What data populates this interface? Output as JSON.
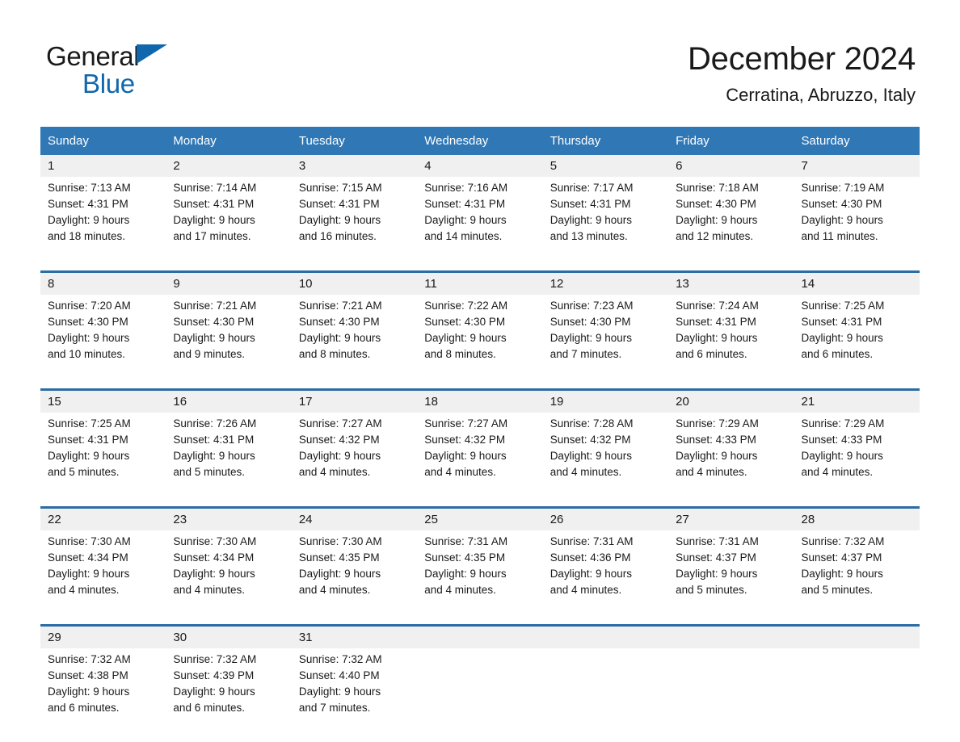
{
  "brand": {
    "name_part1": "General",
    "name_part2": "Blue",
    "triangle_color": "#1067ad",
    "accent_color": "#3077b6"
  },
  "header": {
    "title": "December 2024",
    "subtitle": "Cerratina, Abruzzo, Italy"
  },
  "calendar": {
    "weekdays": [
      "Sunday",
      "Monday",
      "Tuesday",
      "Wednesday",
      "Thursday",
      "Friday",
      "Saturday"
    ],
    "header_bg": "#3077b6",
    "date_band_bg": "#f0f0f0",
    "week_rule_color": "#2b6ca3",
    "weeks": [
      [
        {
          "day": "1",
          "sunrise": "Sunrise: 7:13 AM",
          "sunset": "Sunset: 4:31 PM",
          "daylight_line1": "Daylight: 9 hours",
          "daylight_line2": "and 18 minutes."
        },
        {
          "day": "2",
          "sunrise": "Sunrise: 7:14 AM",
          "sunset": "Sunset: 4:31 PM",
          "daylight_line1": "Daylight: 9 hours",
          "daylight_line2": "and 17 minutes."
        },
        {
          "day": "3",
          "sunrise": "Sunrise: 7:15 AM",
          "sunset": "Sunset: 4:31 PM",
          "daylight_line1": "Daylight: 9 hours",
          "daylight_line2": "and 16 minutes."
        },
        {
          "day": "4",
          "sunrise": "Sunrise: 7:16 AM",
          "sunset": "Sunset: 4:31 PM",
          "daylight_line1": "Daylight: 9 hours",
          "daylight_line2": "and 14 minutes."
        },
        {
          "day": "5",
          "sunrise": "Sunrise: 7:17 AM",
          "sunset": "Sunset: 4:31 PM",
          "daylight_line1": "Daylight: 9 hours",
          "daylight_line2": "and 13 minutes."
        },
        {
          "day": "6",
          "sunrise": "Sunrise: 7:18 AM",
          "sunset": "Sunset: 4:30 PM",
          "daylight_line1": "Daylight: 9 hours",
          "daylight_line2": "and 12 minutes."
        },
        {
          "day": "7",
          "sunrise": "Sunrise: 7:19 AM",
          "sunset": "Sunset: 4:30 PM",
          "daylight_line1": "Daylight: 9 hours",
          "daylight_line2": "and 11 minutes."
        }
      ],
      [
        {
          "day": "8",
          "sunrise": "Sunrise: 7:20 AM",
          "sunset": "Sunset: 4:30 PM",
          "daylight_line1": "Daylight: 9 hours",
          "daylight_line2": "and 10 minutes."
        },
        {
          "day": "9",
          "sunrise": "Sunrise: 7:21 AM",
          "sunset": "Sunset: 4:30 PM",
          "daylight_line1": "Daylight: 9 hours",
          "daylight_line2": "and 9 minutes."
        },
        {
          "day": "10",
          "sunrise": "Sunrise: 7:21 AM",
          "sunset": "Sunset: 4:30 PM",
          "daylight_line1": "Daylight: 9 hours",
          "daylight_line2": "and 8 minutes."
        },
        {
          "day": "11",
          "sunrise": "Sunrise: 7:22 AM",
          "sunset": "Sunset: 4:30 PM",
          "daylight_line1": "Daylight: 9 hours",
          "daylight_line2": "and 8 minutes."
        },
        {
          "day": "12",
          "sunrise": "Sunrise: 7:23 AM",
          "sunset": "Sunset: 4:30 PM",
          "daylight_line1": "Daylight: 9 hours",
          "daylight_line2": "and 7 minutes."
        },
        {
          "day": "13",
          "sunrise": "Sunrise: 7:24 AM",
          "sunset": "Sunset: 4:31 PM",
          "daylight_line1": "Daylight: 9 hours",
          "daylight_line2": "and 6 minutes."
        },
        {
          "day": "14",
          "sunrise": "Sunrise: 7:25 AM",
          "sunset": "Sunset: 4:31 PM",
          "daylight_line1": "Daylight: 9 hours",
          "daylight_line2": "and 6 minutes."
        }
      ],
      [
        {
          "day": "15",
          "sunrise": "Sunrise: 7:25 AM",
          "sunset": "Sunset: 4:31 PM",
          "daylight_line1": "Daylight: 9 hours",
          "daylight_line2": "and 5 minutes."
        },
        {
          "day": "16",
          "sunrise": "Sunrise: 7:26 AM",
          "sunset": "Sunset: 4:31 PM",
          "daylight_line1": "Daylight: 9 hours",
          "daylight_line2": "and 5 minutes."
        },
        {
          "day": "17",
          "sunrise": "Sunrise: 7:27 AM",
          "sunset": "Sunset: 4:32 PM",
          "daylight_line1": "Daylight: 9 hours",
          "daylight_line2": "and 4 minutes."
        },
        {
          "day": "18",
          "sunrise": "Sunrise: 7:27 AM",
          "sunset": "Sunset: 4:32 PM",
          "daylight_line1": "Daylight: 9 hours",
          "daylight_line2": "and 4 minutes."
        },
        {
          "day": "19",
          "sunrise": "Sunrise: 7:28 AM",
          "sunset": "Sunset: 4:32 PM",
          "daylight_line1": "Daylight: 9 hours",
          "daylight_line2": "and 4 minutes."
        },
        {
          "day": "20",
          "sunrise": "Sunrise: 7:29 AM",
          "sunset": "Sunset: 4:33 PM",
          "daylight_line1": "Daylight: 9 hours",
          "daylight_line2": "and 4 minutes."
        },
        {
          "day": "21",
          "sunrise": "Sunrise: 7:29 AM",
          "sunset": "Sunset: 4:33 PM",
          "daylight_line1": "Daylight: 9 hours",
          "daylight_line2": "and 4 minutes."
        }
      ],
      [
        {
          "day": "22",
          "sunrise": "Sunrise: 7:30 AM",
          "sunset": "Sunset: 4:34 PM",
          "daylight_line1": "Daylight: 9 hours",
          "daylight_line2": "and 4 minutes."
        },
        {
          "day": "23",
          "sunrise": "Sunrise: 7:30 AM",
          "sunset": "Sunset: 4:34 PM",
          "daylight_line1": "Daylight: 9 hours",
          "daylight_line2": "and 4 minutes."
        },
        {
          "day": "24",
          "sunrise": "Sunrise: 7:30 AM",
          "sunset": "Sunset: 4:35 PM",
          "daylight_line1": "Daylight: 9 hours",
          "daylight_line2": "and 4 minutes."
        },
        {
          "day": "25",
          "sunrise": "Sunrise: 7:31 AM",
          "sunset": "Sunset: 4:35 PM",
          "daylight_line1": "Daylight: 9 hours",
          "daylight_line2": "and 4 minutes."
        },
        {
          "day": "26",
          "sunrise": "Sunrise: 7:31 AM",
          "sunset": "Sunset: 4:36 PM",
          "daylight_line1": "Daylight: 9 hours",
          "daylight_line2": "and 4 minutes."
        },
        {
          "day": "27",
          "sunrise": "Sunrise: 7:31 AM",
          "sunset": "Sunset: 4:37 PM",
          "daylight_line1": "Daylight: 9 hours",
          "daylight_line2": "and 5 minutes."
        },
        {
          "day": "28",
          "sunrise": "Sunrise: 7:32 AM",
          "sunset": "Sunset: 4:37 PM",
          "daylight_line1": "Daylight: 9 hours",
          "daylight_line2": "and 5 minutes."
        }
      ],
      [
        {
          "day": "29",
          "sunrise": "Sunrise: 7:32 AM",
          "sunset": "Sunset: 4:38 PM",
          "daylight_line1": "Daylight: 9 hours",
          "daylight_line2": "and 6 minutes."
        },
        {
          "day": "30",
          "sunrise": "Sunrise: 7:32 AM",
          "sunset": "Sunset: 4:39 PM",
          "daylight_line1": "Daylight: 9 hours",
          "daylight_line2": "and 6 minutes."
        },
        {
          "day": "31",
          "sunrise": "Sunrise: 7:32 AM",
          "sunset": "Sunset: 4:40 PM",
          "daylight_line1": "Daylight: 9 hours",
          "daylight_line2": "and 7 minutes."
        },
        {
          "day": "",
          "sunrise": "",
          "sunset": "",
          "daylight_line1": "",
          "daylight_line2": ""
        },
        {
          "day": "",
          "sunrise": "",
          "sunset": "",
          "daylight_line1": "",
          "daylight_line2": ""
        },
        {
          "day": "",
          "sunrise": "",
          "sunset": "",
          "daylight_line1": "",
          "daylight_line2": ""
        },
        {
          "day": "",
          "sunrise": "",
          "sunset": "",
          "daylight_line1": "",
          "daylight_line2": ""
        }
      ]
    ]
  }
}
